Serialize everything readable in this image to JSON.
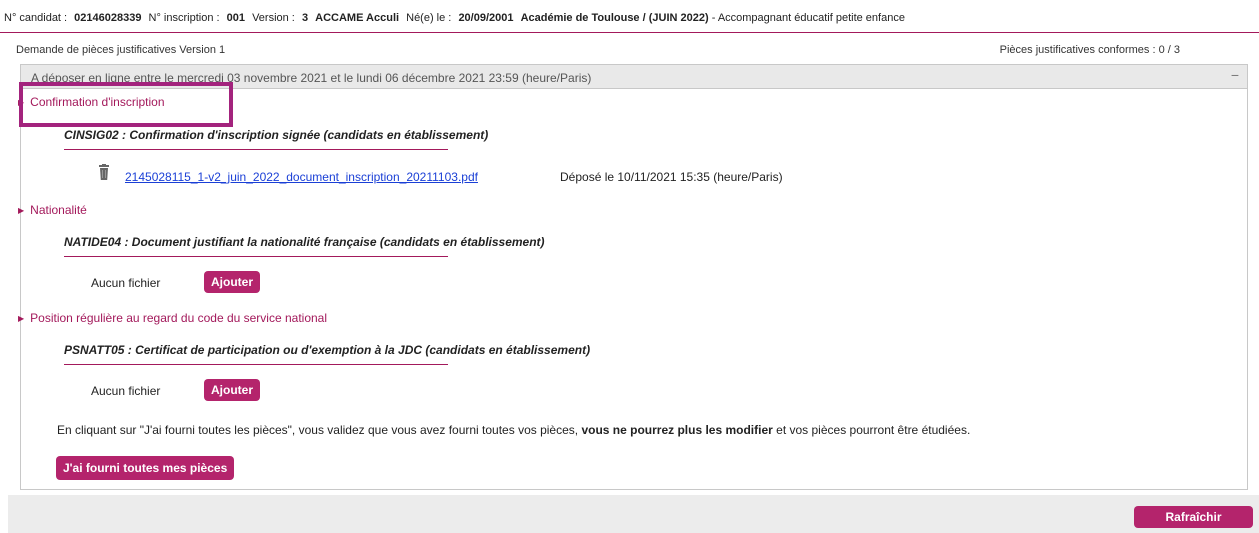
{
  "header": {
    "candidat_label": "N° candidat :",
    "candidat_value": "02146028339",
    "inscription_label": "N° inscription :",
    "inscription_value": "001",
    "version_label": "Version :",
    "version_value": "3",
    "name": "ACCAME Acculi",
    "birth_label": "Né(e) le :",
    "birth_value": "20/09/2001",
    "academy": "Académie de Toulouse / (JUIN 2022)",
    "diploma": "- Accompagnant éducatif petite enfance"
  },
  "subhead": {
    "left": "Demande de pièces justificatives Version 1",
    "right": "Pièces justificatives conformes : 0 / 3"
  },
  "panel": {
    "head": "A déposer en ligne entre le mercredi 03 novembre 2021 et le lundi 06 décembre 2021 23:59 (heure/Paris)",
    "collapse": "−"
  },
  "sections": [
    {
      "title": "Confirmation d'inscription",
      "doc": "CINSIG02 : Confirmation d'inscription signée (candidats en établissement)",
      "file": "2145028115_1-v2_juin_2022_document_inscription_20211103.pdf",
      "deposit": "Déposé le 10/11/2021 15:35 (heure/Paris)"
    },
    {
      "title": "Nationalité",
      "doc": "NATIDE04 : Document justifiant la nationalité française (candidats en établissement)",
      "no_file": "Aucun fichier",
      "button": "Ajouter"
    },
    {
      "title": "Position régulière au regard du code du service national",
      "doc": "PSNATT05 : Certificat de participation ou d'exemption à la JDC (candidats en établissement)",
      "no_file": "Aucun fichier",
      "button": "Ajouter"
    }
  ],
  "info": {
    "part1": "En cliquant sur \"J'ai fourni toutes les pièces\", vous validez que vous avez fourni toutes vos pièces,",
    "bold": "vous ne pourrez plus les modifier",
    "part2": "et vos pièces pourront être étudiées.",
    "button": "J'ai fourni toutes mes pièces"
  },
  "footer": {
    "refresh": "Rafraîchir"
  },
  "colors": {
    "accent": "#a3195b",
    "button": "#b4246c",
    "link": "#1a3fd6"
  }
}
